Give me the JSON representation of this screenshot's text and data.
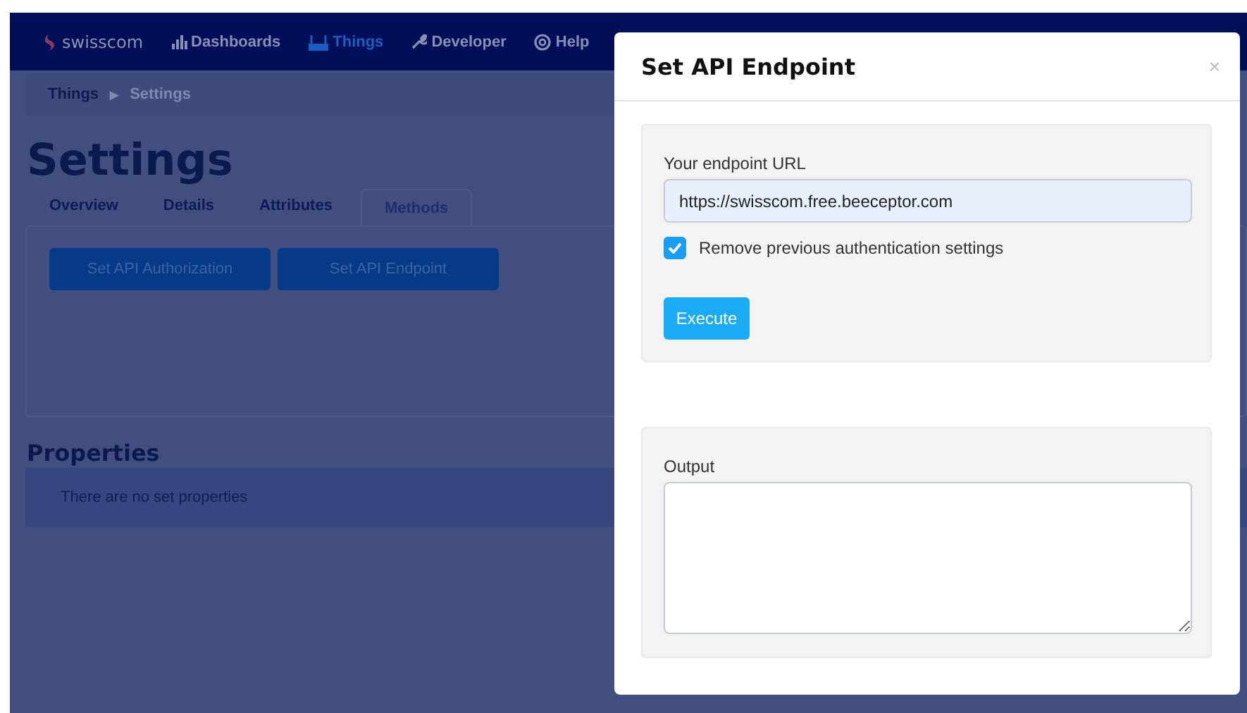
{
  "navbar": {
    "brand": "swisscom",
    "items": [
      {
        "label": "Dashboards",
        "selected": false
      },
      {
        "label": "Things",
        "selected": true
      },
      {
        "label": "Developer",
        "selected": false
      },
      {
        "label": "Help",
        "selected": false
      }
    ]
  },
  "breadcrumb": [
    {
      "label": "Things",
      "current": false
    },
    {
      "label": "Settings",
      "current": true
    }
  ],
  "breadcrumb_separator": "▶",
  "heading": "Settings",
  "tabs": [
    {
      "label": "Overview",
      "selected": false
    },
    {
      "label": "Details",
      "selected": false
    },
    {
      "label": "Attributes",
      "selected": false
    },
    {
      "label": "Methods",
      "selected": true
    }
  ],
  "method_buttons": [
    "Set API Authorization",
    "Set API Endpoint"
  ],
  "properties": {
    "title": "Properties",
    "empty_text": "There are no set properties"
  },
  "modal": {
    "title": "Set API Endpoint",
    "close": "×",
    "url_label": "Your endpoint URL",
    "url_value": "https://swisscom.free.beeceptor.com",
    "remove_auth": {
      "label": "Remove previous authentication settings",
      "checked": true
    },
    "execute": "Execute",
    "output_label": "Output"
  }
}
